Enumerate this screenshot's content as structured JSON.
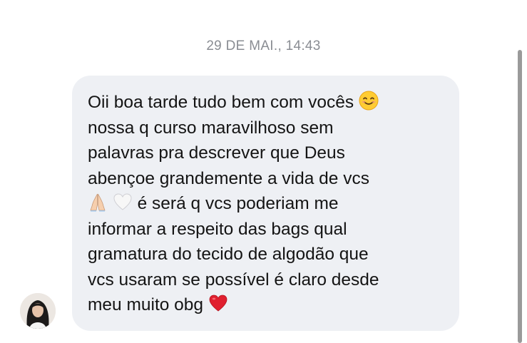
{
  "thread": {
    "timestamp": "29 DE MAI., 14:43"
  },
  "message": {
    "lines": [
      "Oii boa tarde tudo bem com vocês",
      "nossa q curso maravilhoso sem",
      "palavras pra descrever que Deus",
      "abençoe grandemente a vida de vcs",
      "é será q vcs poderiam me",
      "informar a respeito das bags qual",
      "gramatura do tecido de algodão que",
      "vcs usaram se possível é claro desde",
      "meu muito obg"
    ],
    "emojis": [
      "smiling-face-emoji",
      "folded-hands-emoji",
      "white-heart-emoji",
      "red-heart-emoji"
    ]
  },
  "colors": {
    "bubble_bg": "#eef0f4",
    "text": "#141414",
    "timestamp": "#8a8d93",
    "heart": "#e0202f"
  }
}
